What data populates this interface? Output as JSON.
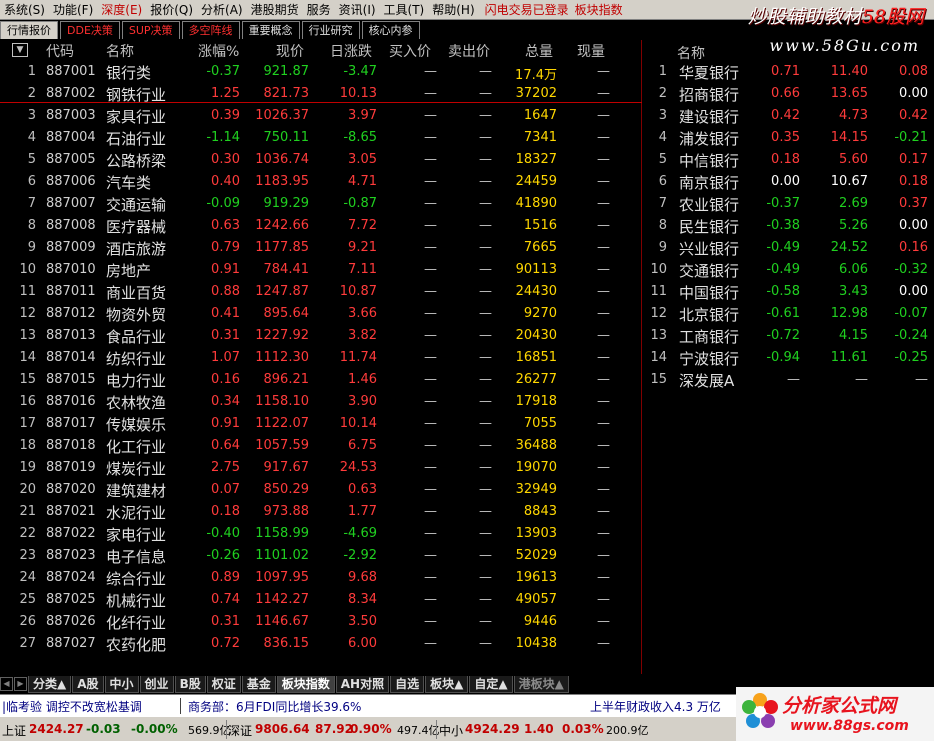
{
  "menubar": {
    "items": [
      {
        "label": "系统(S)",
        "hl": false
      },
      {
        "label": "功能(F)",
        "hl": false
      },
      {
        "label": "深度(E)",
        "hl": true
      },
      {
        "label": "报价(Q)",
        "hl": false
      },
      {
        "label": "分析(A)",
        "hl": false
      },
      {
        "label": "港股期货",
        "hl": false
      },
      {
        "label": "服务",
        "hl": false
      },
      {
        "label": "资讯(I)",
        "hl": false
      },
      {
        "label": "工具(T)",
        "hl": false
      },
      {
        "label": "帮助(H)",
        "hl": false
      }
    ],
    "notice": "闪电交易已登录",
    "context": "板块指数"
  },
  "watermark": {
    "title_a": "炒股辅助教材",
    "title_b": "58股网",
    "url": "www.58Gu.com"
  },
  "top_tabs": [
    {
      "label": "行情报价",
      "style": "active"
    },
    {
      "label": "DDE决策",
      "style": "red"
    },
    {
      "label": "SUP决策",
      "style": "red"
    },
    {
      "label": "多空阵线",
      "style": "red"
    },
    {
      "label": "重要概念",
      "style": "white"
    },
    {
      "label": "行业研究",
      "style": "white"
    },
    {
      "label": "核心内参",
      "style": "white"
    }
  ],
  "table": {
    "sort_glyph": "▼",
    "headers": {
      "code": "代码",
      "name": "名称",
      "chg_pct": "涨幅%",
      "price": "现价",
      "diff": "日涨跌",
      "bid": "买入价",
      "ask": "卖出价",
      "vol": "总量",
      "cur_vol": "现量"
    },
    "rows": [
      {
        "idx": "1",
        "code": "887001",
        "name": "银行类",
        "chg": "-0.37",
        "price": "921.87",
        "diff": "-3.47",
        "bid": "—",
        "ask": "—",
        "vol": "17.4万",
        "cur": "—",
        "dir": "down"
      },
      {
        "idx": "2",
        "code": "887002",
        "name": "钢铁行业",
        "chg": "1.25",
        "price": "821.73",
        "diff": "10.13",
        "bid": "—",
        "ask": "—",
        "vol": "37202",
        "cur": "—",
        "dir": "up"
      },
      {
        "idx": "3",
        "code": "887003",
        "name": "家具行业",
        "chg": "0.39",
        "price": "1026.37",
        "diff": "3.97",
        "bid": "—",
        "ask": "—",
        "vol": "1647",
        "cur": "—",
        "dir": "up"
      },
      {
        "idx": "4",
        "code": "887004",
        "name": "石油行业",
        "chg": "-1.14",
        "price": "750.11",
        "diff": "-8.65",
        "bid": "—",
        "ask": "—",
        "vol": "7341",
        "cur": "—",
        "dir": "down"
      },
      {
        "idx": "5",
        "code": "887005",
        "name": "公路桥梁",
        "chg": "0.30",
        "price": "1036.74",
        "diff": "3.05",
        "bid": "—",
        "ask": "—",
        "vol": "18327",
        "cur": "—",
        "dir": "up"
      },
      {
        "idx": "6",
        "code": "887006",
        "name": "汽车类",
        "chg": "0.40",
        "price": "1183.95",
        "diff": "4.71",
        "bid": "—",
        "ask": "—",
        "vol": "24459",
        "cur": "—",
        "dir": "up"
      },
      {
        "idx": "7",
        "code": "887007",
        "name": "交通运输",
        "chg": "-0.09",
        "price": "919.29",
        "diff": "-0.87",
        "bid": "—",
        "ask": "—",
        "vol": "41890",
        "cur": "—",
        "dir": "down"
      },
      {
        "idx": "8",
        "code": "887008",
        "name": "医疗器械",
        "chg": "0.63",
        "price": "1242.66",
        "diff": "7.72",
        "bid": "—",
        "ask": "—",
        "vol": "1516",
        "cur": "—",
        "dir": "up"
      },
      {
        "idx": "9",
        "code": "887009",
        "name": "酒店旅游",
        "chg": "0.79",
        "price": "1177.85",
        "diff": "9.21",
        "bid": "—",
        "ask": "—",
        "vol": "7665",
        "cur": "—",
        "dir": "up"
      },
      {
        "idx": "10",
        "code": "887010",
        "name": "房地产",
        "chg": "0.91",
        "price": "784.41",
        "diff": "7.11",
        "bid": "—",
        "ask": "—",
        "vol": "90113",
        "cur": "—",
        "dir": "up"
      },
      {
        "idx": "11",
        "code": "887011",
        "name": "商业百货",
        "chg": "0.88",
        "price": "1247.87",
        "diff": "10.87",
        "bid": "—",
        "ask": "—",
        "vol": "24430",
        "cur": "—",
        "dir": "up"
      },
      {
        "idx": "12",
        "code": "887012",
        "name": "物资外贸",
        "chg": "0.41",
        "price": "895.64",
        "diff": "3.66",
        "bid": "—",
        "ask": "—",
        "vol": "9270",
        "cur": "—",
        "dir": "up"
      },
      {
        "idx": "13",
        "code": "887013",
        "name": "食品行业",
        "chg": "0.31",
        "price": "1227.92",
        "diff": "3.82",
        "bid": "—",
        "ask": "—",
        "vol": "20430",
        "cur": "—",
        "dir": "up"
      },
      {
        "idx": "14",
        "code": "887014",
        "name": "纺织行业",
        "chg": "1.07",
        "price": "1112.30",
        "diff": "11.74",
        "bid": "—",
        "ask": "—",
        "vol": "16851",
        "cur": "—",
        "dir": "up"
      },
      {
        "idx": "15",
        "code": "887015",
        "name": "电力行业",
        "chg": "0.16",
        "price": "896.21",
        "diff": "1.46",
        "bid": "—",
        "ask": "—",
        "vol": "26277",
        "cur": "—",
        "dir": "up"
      },
      {
        "idx": "16",
        "code": "887016",
        "name": "农林牧渔",
        "chg": "0.34",
        "price": "1158.10",
        "diff": "3.90",
        "bid": "—",
        "ask": "—",
        "vol": "17918",
        "cur": "—",
        "dir": "up"
      },
      {
        "idx": "17",
        "code": "887017",
        "name": "传媒娱乐",
        "chg": "0.91",
        "price": "1122.07",
        "diff": "10.14",
        "bid": "—",
        "ask": "—",
        "vol": "7055",
        "cur": "—",
        "dir": "up"
      },
      {
        "idx": "18",
        "code": "887018",
        "name": "化工行业",
        "chg": "0.64",
        "price": "1057.59",
        "diff": "6.75",
        "bid": "—",
        "ask": "—",
        "vol": "36488",
        "cur": "—",
        "dir": "up"
      },
      {
        "idx": "19",
        "code": "887019",
        "name": "煤炭行业",
        "chg": "2.75",
        "price": "917.67",
        "diff": "24.53",
        "bid": "—",
        "ask": "—",
        "vol": "19070",
        "cur": "—",
        "dir": "up"
      },
      {
        "idx": "20",
        "code": "887020",
        "name": "建筑建材",
        "chg": "0.07",
        "price": "850.29",
        "diff": "0.63",
        "bid": "—",
        "ask": "—",
        "vol": "32949",
        "cur": "—",
        "dir": "up"
      },
      {
        "idx": "21",
        "code": "887021",
        "name": "水泥行业",
        "chg": "0.18",
        "price": "973.88",
        "diff": "1.77",
        "bid": "—",
        "ask": "—",
        "vol": "8843",
        "cur": "—",
        "dir": "up"
      },
      {
        "idx": "22",
        "code": "887022",
        "name": "家电行业",
        "chg": "-0.40",
        "price": "1158.99",
        "diff": "-4.69",
        "bid": "—",
        "ask": "—",
        "vol": "13903",
        "cur": "—",
        "dir": "down"
      },
      {
        "idx": "23",
        "code": "887023",
        "name": "电子信息",
        "chg": "-0.26",
        "price": "1101.02",
        "diff": "-2.92",
        "bid": "—",
        "ask": "—",
        "vol": "52029",
        "cur": "—",
        "dir": "down"
      },
      {
        "idx": "24",
        "code": "887024",
        "name": "综合行业",
        "chg": "0.89",
        "price": "1097.95",
        "diff": "9.68",
        "bid": "—",
        "ask": "—",
        "vol": "19613",
        "cur": "—",
        "dir": "up"
      },
      {
        "idx": "25",
        "code": "887025",
        "name": "机械行业",
        "chg": "0.74",
        "price": "1142.27",
        "diff": "8.34",
        "bid": "—",
        "ask": "—",
        "vol": "49057",
        "cur": "—",
        "dir": "up"
      },
      {
        "idx": "26",
        "code": "887026",
        "name": "化纤行业",
        "chg": "0.31",
        "price": "1146.67",
        "diff": "3.50",
        "bid": "—",
        "ask": "—",
        "vol": "9446",
        "cur": "—",
        "dir": "up"
      },
      {
        "idx": "27",
        "code": "887027",
        "name": "农药化肥",
        "chg": "0.72",
        "price": "836.15",
        "diff": "6.00",
        "bid": "—",
        "ask": "—",
        "vol": "10438",
        "cur": "—",
        "dir": "up"
      }
    ]
  },
  "right_panel": {
    "header": "名称",
    "rows": [
      {
        "idx": "1",
        "name": "华夏银行",
        "chg": "0.71",
        "price": "11.40",
        "diff": "0.08",
        "dir": "up"
      },
      {
        "idx": "2",
        "name": "招商银行",
        "chg": "0.66",
        "price": "13.65",
        "diff": "0.00",
        "dir": "up",
        "price_dir": "up",
        "diff_dir": "flat"
      },
      {
        "idx": "3",
        "name": "建设银行",
        "chg": "0.42",
        "price": "4.73",
        "diff": "0.42",
        "dir": "up"
      },
      {
        "idx": "4",
        "name": "浦发银行",
        "chg": "0.35",
        "price": "14.15",
        "diff": "-0.21",
        "dir": "up",
        "diff_dir": "down"
      },
      {
        "idx": "5",
        "name": "中信银行",
        "chg": "0.18",
        "price": "5.60",
        "diff": "0.17",
        "dir": "up"
      },
      {
        "idx": "6",
        "name": "南京银行",
        "chg": "0.00",
        "price": "10.67",
        "diff": "0.18",
        "dir": "flat",
        "diff_dir": "up"
      },
      {
        "idx": "7",
        "name": "农业银行",
        "chg": "-0.37",
        "price": "2.69",
        "diff": "0.37",
        "dir": "down",
        "diff_dir": "up"
      },
      {
        "idx": "8",
        "name": "民生银行",
        "chg": "-0.38",
        "price": "5.26",
        "diff": "0.00",
        "dir": "down",
        "diff_dir": "flat"
      },
      {
        "idx": "9",
        "name": "兴业银行",
        "chg": "-0.49",
        "price": "24.52",
        "diff": "0.16",
        "dir": "down",
        "diff_dir": "up"
      },
      {
        "idx": "10",
        "name": "交通银行",
        "chg": "-0.49",
        "price": "6.06",
        "diff": "-0.32",
        "dir": "down"
      },
      {
        "idx": "11",
        "name": "中国银行",
        "chg": "-0.58",
        "price": "3.43",
        "diff": "0.00",
        "dir": "down",
        "diff_dir": "flat"
      },
      {
        "idx": "12",
        "name": "北京银行",
        "chg": "-0.61",
        "price": "12.98",
        "diff": "-0.07",
        "dir": "down"
      },
      {
        "idx": "13",
        "name": "工商银行",
        "chg": "-0.72",
        "price": "4.15",
        "diff": "-0.24",
        "dir": "down"
      },
      {
        "idx": "14",
        "name": "宁波银行",
        "chg": "-0.94",
        "price": "11.61",
        "diff": "-0.25",
        "dir": "down"
      },
      {
        "idx": "15",
        "name": "深发展A",
        "chg": "—",
        "price": "—",
        "diff": "—",
        "dir": "none"
      }
    ]
  },
  "bottom_tabs": [
    {
      "label": "分类▲",
      "active": false
    },
    {
      "label": "A股",
      "active": false
    },
    {
      "label": "中小",
      "active": false
    },
    {
      "label": "创业",
      "active": false
    },
    {
      "label": "B股",
      "active": false
    },
    {
      "label": "权证",
      "active": false
    },
    {
      "label": "基金",
      "active": false
    },
    {
      "label": "板块指数",
      "active": true
    },
    {
      "label": "AH对照",
      "active": false
    },
    {
      "label": "自选",
      "active": false
    },
    {
      "label": "板块▲",
      "active": false
    },
    {
      "label": "自定▲",
      "active": false
    },
    {
      "label": "港板块▲",
      "active": false,
      "dim": true
    }
  ],
  "news": {
    "item1": "|临考验 调控不改宽松基调",
    "item2": "商务部：6月FDI同比增长39.6%",
    "item3": "上半年财政收入4.3 万亿"
  },
  "status": {
    "sh_label": "上证",
    "sh_value": "2424.27",
    "sh_chg": "-0.03",
    "sh_pct": "-0.00%",
    "sh_amt": "569.9亿",
    "sz_label": "深证",
    "sz_value": "9806.64",
    "sz_chg": "87.92",
    "sz_pct": "0.90%",
    "sz_amt": "497.4亿",
    "zx_label": "中小",
    "zx_value": "4924.29",
    "zx_chg": "1.40",
    "zx_pct": "0.03%",
    "zx_amt": "200.9亿"
  },
  "logo": {
    "text": "分析家公式网",
    "url": "www.88gs.com"
  },
  "colors": {
    "up": "#ff3b3b",
    "down": "#20d020",
    "flat": "#ffffff",
    "volume": "#ffd700"
  }
}
